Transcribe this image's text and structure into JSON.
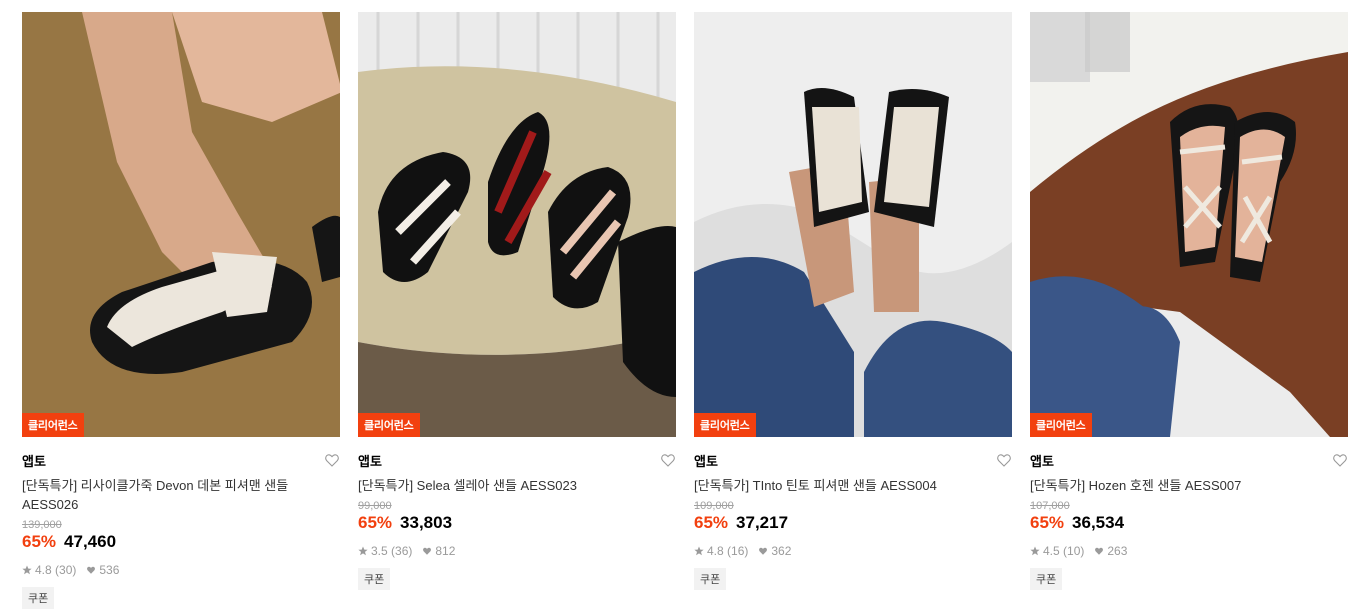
{
  "products": [
    {
      "badge": "클리어런스",
      "brand": "앱토",
      "name": "[단독특가] 리사이클가죽 Devon 데본 피셔맨 샌들 AESS026",
      "original_price": "139,000",
      "discount": "65%",
      "price": "47,460",
      "rating": "4.8",
      "reviews": "(30)",
      "likes": "536",
      "coupon": "쿠폰",
      "image_icon": "fisherman-sandal-photo"
    },
    {
      "badge": "클리어런스",
      "brand": "앱토",
      "name": "[단독특가] Selea 셀레아 샌들 AESS023",
      "original_price": "99,000",
      "discount": "65%",
      "price": "33,803",
      "rating": "3.5",
      "reviews": "(36)",
      "likes": "812",
      "coupon": "쿠폰",
      "image_icon": "strappy-sandals-photo"
    },
    {
      "badge": "클리어런스",
      "brand": "앱토",
      "name": "[단독특가] TInto 틴토 피셔맨 샌들 AESS004",
      "original_price": "109,000",
      "discount": "65%",
      "price": "37,217",
      "rating": "4.8",
      "reviews": "(16)",
      "likes": "362",
      "coupon": "쿠폰",
      "image_icon": "fisherman-sandal-photo"
    },
    {
      "badge": "클리어런스",
      "brand": "앱토",
      "name": "[단독특가] Hozen 호젠 샌들 AESS007",
      "original_price": "107,000",
      "discount": "65%",
      "price": "36,534",
      "rating": "4.5",
      "reviews": "(10)",
      "likes": "263",
      "coupon": "쿠폰",
      "image_icon": "cross-strap-sandal-photo"
    }
  ],
  "colors": {
    "accent": "#f2400f",
    "muted": "#9a9a9a",
    "coupon_bg": "#f2f2f2"
  }
}
